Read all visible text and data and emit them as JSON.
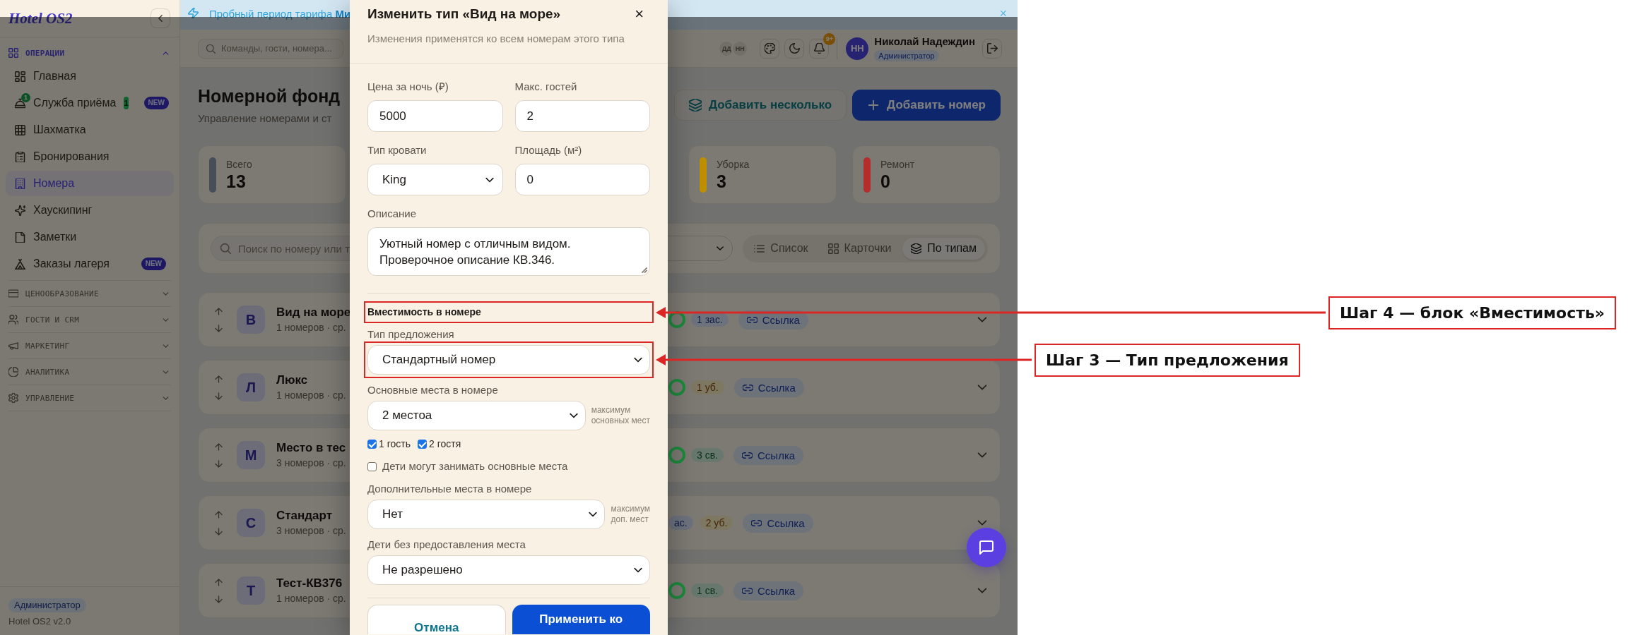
{
  "banner": {
    "text": "Пробный период тарифа **Ми**",
    "close": "×"
  },
  "sidebar": {
    "logo": "Hotel OS2",
    "sections": [
      {
        "title": "ОПЕРАЦИИ",
        "expanded": true,
        "items": [
          {
            "label": "Главная",
            "selected": false
          },
          {
            "label": "Служба приёма",
            "selected": false,
            "icon_badge": "1",
            "count": "1",
            "tag": "NEW"
          },
          {
            "label": "Шахматка",
            "selected": false
          },
          {
            "label": "Бронирования",
            "selected": false
          },
          {
            "label": "Номера",
            "selected": true
          },
          {
            "label": "Хаускипинг",
            "selected": false
          },
          {
            "label": "Заметки",
            "selected": false
          },
          {
            "label": "Заказы лагеря",
            "selected": false,
            "tag": "NEW"
          }
        ]
      },
      {
        "title": "ЦЕНООБРАЗОВАНИЕ",
        "expanded": false
      },
      {
        "title": "ГОСТИ И CRM",
        "expanded": false
      },
      {
        "title": "МАРКЕТИНГ",
        "expanded": false
      },
      {
        "title": "АНАЛИТИКА",
        "expanded": false
      },
      {
        "title": "УПРАВЛЕНИЕ",
        "expanded": false
      }
    ],
    "role": "Администратор",
    "version": "Hotel OS2 v2.0"
  },
  "topbar": {
    "search_placeholder": "Команды, гости, номера...",
    "presence": [
      "ДД",
      "НН"
    ],
    "notifications": "9+",
    "user": {
      "initials": "НН",
      "name": "Николай Надеждин",
      "role": "Администратор"
    }
  },
  "page": {
    "title": "Номерной фонд",
    "subtitle": "Управление номерами и ст",
    "actions": [
      {
        "label": "Добавить несколько",
        "kind": "secondary"
      },
      {
        "label": "Добавить номер",
        "kind": "primary"
      }
    ]
  },
  "stats": [
    {
      "label": "Всего",
      "value": "13",
      "color": "#474e58"
    },
    {
      "label": "Уборка",
      "value": "3",
      "color": "#c08f00"
    },
    {
      "label": "Ремонт",
      "value": "0",
      "color": "#b52c2c"
    }
  ],
  "filters": {
    "search_placeholder": "Поиск по номеру или т",
    "views": [
      {
        "label": "Список",
        "selected": false
      },
      {
        "label": "Карточки",
        "selected": false
      },
      {
        "label": "По типам",
        "selected": true
      }
    ]
  },
  "room_types": [
    {
      "letter": "В",
      "name": "Вид на море",
      "meta": "1 номеров · ср.",
      "ring": true,
      "badges": [
        {
          "text": "1 зас.",
          "kind": "occupied"
        }
      ],
      "link": "Ссылка"
    },
    {
      "letter": "Л",
      "name": "Люкс",
      "meta": "1 номеров · ср.",
      "ring": true,
      "badges": [
        {
          "text": "1 уб.",
          "kind": "cleaning"
        }
      ],
      "link": "Ссылка"
    },
    {
      "letter": "М",
      "name": "Место в тес",
      "meta": "3 номеров · ср.",
      "ring": true,
      "badges": [
        {
          "text": "3 св.",
          "kind": "free"
        }
      ],
      "link": "Ссылка"
    },
    {
      "letter": "С",
      "name": "Стандарт",
      "meta": "3 номеров · ср.",
      "ring": false,
      "badges": [
        {
          "text": "ас.",
          "kind": "occupied"
        },
        {
          "text": "2 уб.",
          "kind": "cleaning"
        }
      ],
      "link": "Ссылка"
    },
    {
      "letter": "Т",
      "name": "Тест-КВ376",
      "meta": "1 номеров · ср.",
      "ring": true,
      "badges": [
        {
          "text": "1 св.",
          "kind": "free"
        }
      ],
      "link": "Ссылка"
    }
  ],
  "modal": {
    "title": "Изменить тип «Вид на море»",
    "close": "×",
    "subtitle": "Изменения применятся ко всем номерам этого типа",
    "fields": [
      {
        "label": "Цена за ночь (₽)",
        "kind": "input",
        "value": "5000"
      },
      {
        "label": "Макс. гостей",
        "kind": "input",
        "value": "2"
      },
      {
        "label": "Тип кровати",
        "kind": "select",
        "value": "King"
      },
      {
        "label": "Площадь (м²)",
        "kind": "input",
        "value": "0"
      },
      {
        "label": "Описание",
        "kind": "textarea",
        "value": "Уютный номер с отличным видом.\nПроверочное описание КВ.346."
      }
    ],
    "capacity": {
      "heading": "Вместимость в номере",
      "callout": "Шаг 4 — блок «Вместимость»",
      "items": [
        {
          "kind": "select",
          "label": "Тип предложения",
          "value": "Стандартный номер",
          "callout": "Шаг 3 — Тип предложения"
        },
        {
          "kind": "select",
          "label": "Основные места в номере",
          "value": "2 местоа",
          "hint": "максимум\nосновных мест"
        },
        {
          "kind": "checks",
          "options": [
            {
              "label": "1 гость",
              "checked": true
            },
            {
              "label": "2 гостя",
              "checked": true
            }
          ]
        },
        {
          "kind": "checkbox",
          "label": "Дети могут занимать основные места",
          "checked": false
        },
        {
          "kind": "select",
          "label": "Дополнительные места в номере",
          "value": "Нет",
          "hint": "максимум\nдоп. мест"
        },
        {
          "kind": "select",
          "label": "Дети без предоставления места",
          "value": "Не разрешено"
        }
      ]
    },
    "buttons": [
      {
        "label": "Отмена",
        "kind": "secondary"
      },
      {
        "label": "Применить ко",
        "kind": "primary"
      }
    ]
  }
}
